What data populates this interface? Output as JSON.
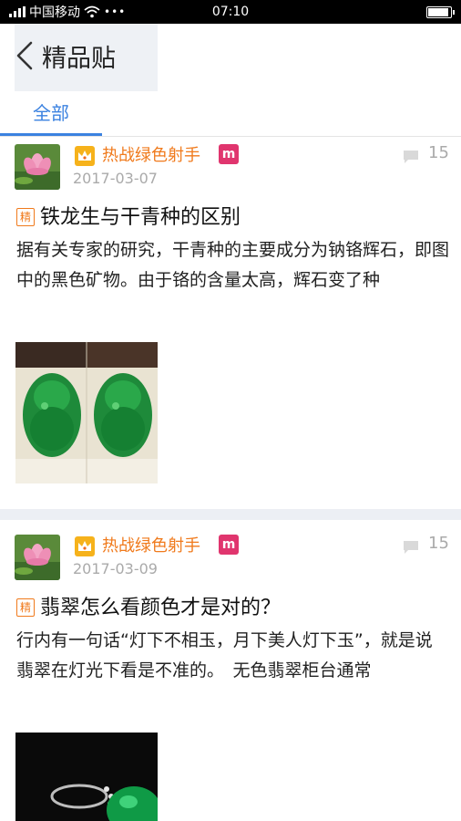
{
  "status_bar": {
    "carrier": "中国移动",
    "time": "07:10",
    "dots": "•••"
  },
  "header": {
    "title": "精品贴"
  },
  "tabs": [
    {
      "label": "全部",
      "active": true
    }
  ],
  "posts": [
    {
      "author": "热战绿色射手",
      "medal": "m",
      "date": "2017-03-07",
      "comment_count": "15",
      "tag": "精",
      "title": "铁龙生与干青种的区别",
      "excerpt": "据有关专家的研究，干青种的主要成分为钠铬辉石，即图中的黑色矿物。由于铬的含量太高，辉石变了种"
    },
    {
      "author": "热战绿色射手",
      "medal": "m",
      "date": "2017-03-09",
      "comment_count": "15",
      "tag": "精",
      "title": "翡翠怎么看颜色才是对的？",
      "excerpt": "行内有一句话“灯下不相玉，月下美人灯下玉”，就是说翡翠在灯光下看是不准的。　无色翡翠柜台通常"
    }
  ],
  "colors": {
    "accent": "#3b82e0",
    "author": "#f07a1c",
    "medal": "#e0356e",
    "divider": "#eceff4"
  }
}
